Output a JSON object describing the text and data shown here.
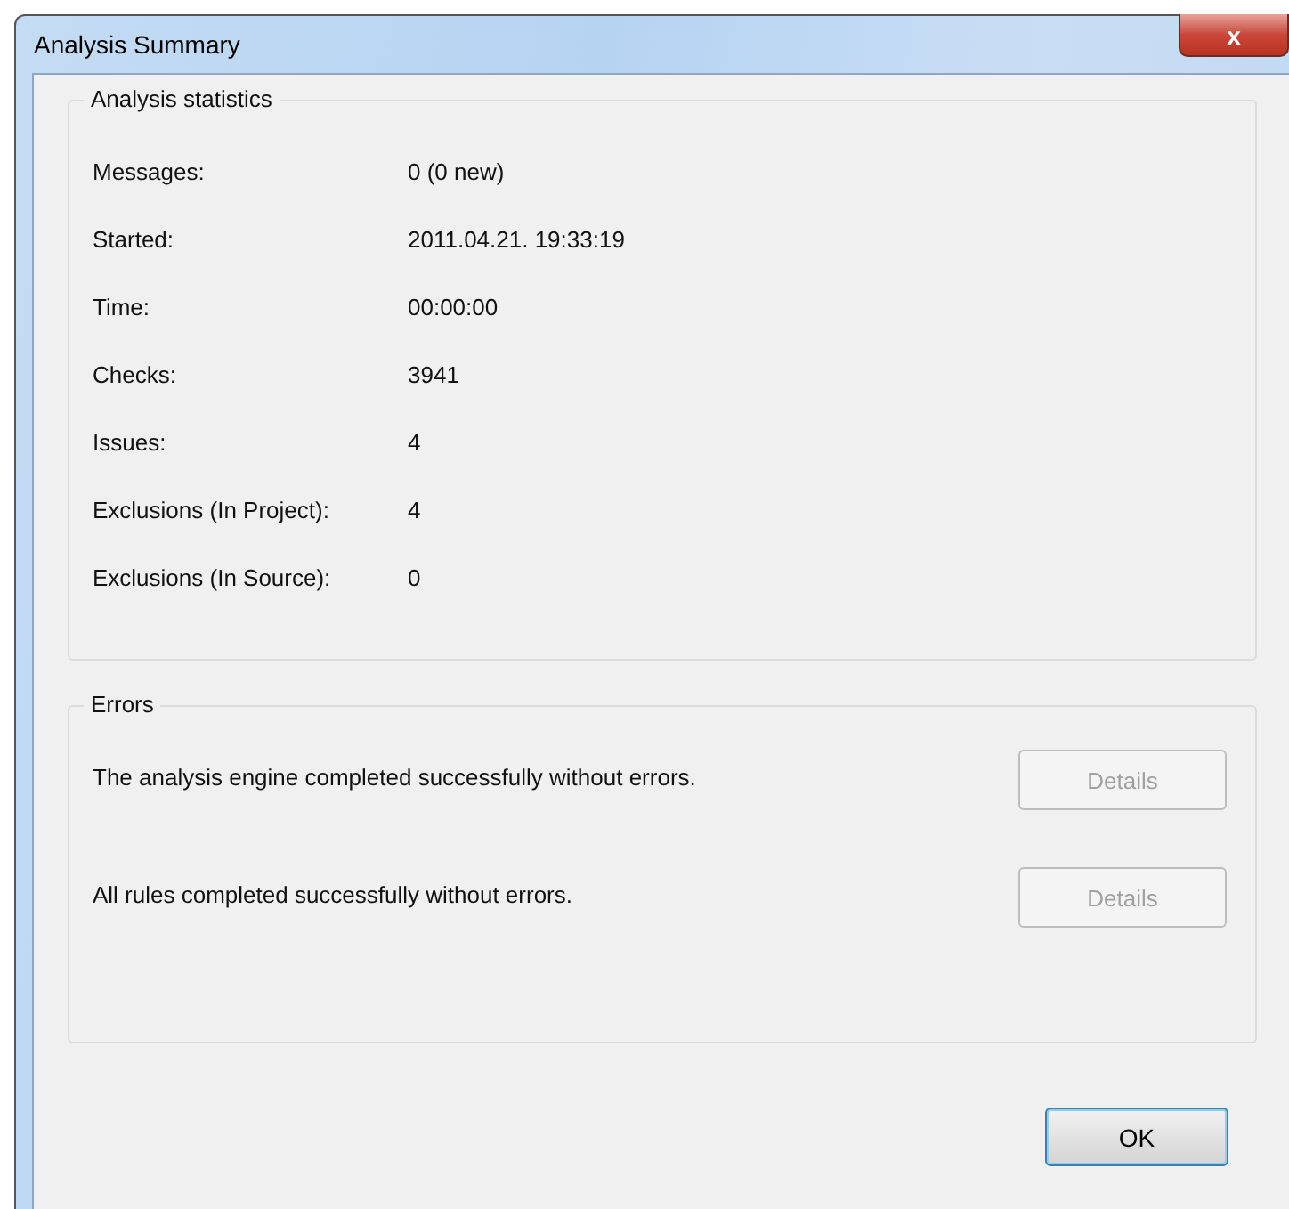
{
  "window": {
    "title": "Analysis Summary",
    "close_label": "x"
  },
  "statistics": {
    "title": "Analysis statistics",
    "rows": [
      {
        "label": "Messages:",
        "value": "0 (0 new)"
      },
      {
        "label": "Started:",
        "value": "2011.04.21. 19:33:19"
      },
      {
        "label": "Time:",
        "value": "00:00:00"
      },
      {
        "label": "Checks:",
        "value": "3941"
      },
      {
        "label": "Issues:",
        "value": "4"
      },
      {
        "label": "Exclusions (In Project):",
        "value": "4"
      },
      {
        "label": "Exclusions (In Source):",
        "value": "0"
      }
    ]
  },
  "errors": {
    "title": "Errors",
    "items": [
      {
        "message": "The analysis engine completed successfully without errors.",
        "button": "Details",
        "disabled": true
      },
      {
        "message": "All rules completed successfully without errors.",
        "button": "Details",
        "disabled": true
      }
    ]
  },
  "buttons": [
    "OK"
  ]
}
